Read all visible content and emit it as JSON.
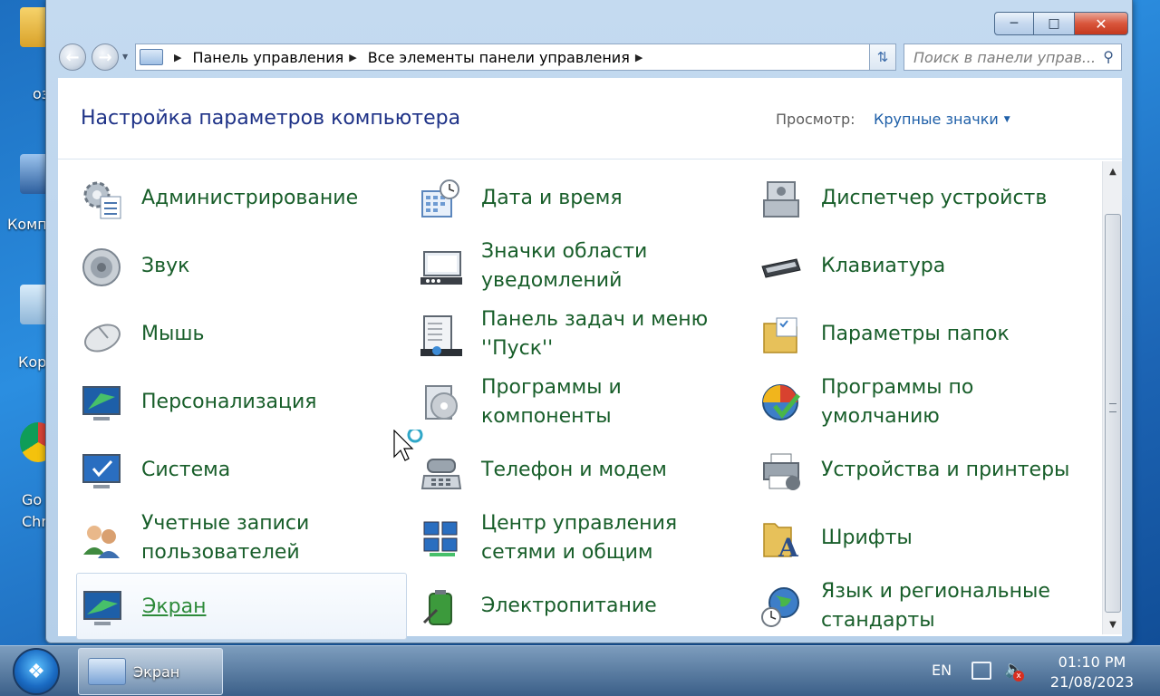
{
  "desktop": {
    "icons": [
      {
        "label": "oз"
      },
      {
        "label": "Комп"
      },
      {
        "label": "Кор"
      },
      {
        "label": "Go"
      },
      {
        "label": "Chr"
      }
    ]
  },
  "window": {
    "address": {
      "segments": [
        "Панель управления",
        "Все элементы панели управления"
      ]
    },
    "search": {
      "placeholder": "Поиск в панели управ..."
    },
    "header": {
      "title": "Настройка параметров компьютера",
      "view_label": "Просмотр:",
      "view_value": "Крупные значки"
    },
    "items": [
      {
        "label": "Администрирование",
        "icon": "admin-tools-icon"
      },
      {
        "label": "Дата и время",
        "icon": "calendar-clock-icon"
      },
      {
        "label": "Диспетчер устройств",
        "icon": "device-manager-icon"
      },
      {
        "label": "Звук",
        "icon": "speaker-icon"
      },
      {
        "label": "Значки области уведомлений",
        "icon": "notification-area-icon"
      },
      {
        "label": "Клавиатура",
        "icon": "keyboard-icon"
      },
      {
        "label": "Мышь",
        "icon": "mouse-icon"
      },
      {
        "label": "Панель задач и меню ''Пуск''",
        "icon": "taskbar-start-icon"
      },
      {
        "label": "Параметры папок",
        "icon": "folder-options-icon"
      },
      {
        "label": "Персонализация",
        "icon": "personalization-icon"
      },
      {
        "label": "Программы и компоненты",
        "icon": "programs-features-icon"
      },
      {
        "label": "Программы по умолчанию",
        "icon": "default-programs-icon"
      },
      {
        "label": "Система",
        "icon": "system-icon"
      },
      {
        "label": "Телефон и модем",
        "icon": "phone-modem-icon"
      },
      {
        "label": "Устройства и принтеры",
        "icon": "devices-printers-icon"
      },
      {
        "label": "Учетные записи пользователей",
        "icon": "user-accounts-icon"
      },
      {
        "label": "Центр управления сетями и общим",
        "icon": "network-center-icon"
      },
      {
        "label": "Шрифты",
        "icon": "fonts-folder-icon"
      },
      {
        "label": "Экран",
        "icon": "display-icon",
        "selected": true
      },
      {
        "label": "Электропитание",
        "icon": "power-options-icon"
      },
      {
        "label": "Язык и региональные стандарты",
        "icon": "region-globe-icon"
      }
    ]
  },
  "taskbar": {
    "active_window": "Экран",
    "language": "EN",
    "time": "01:10 PM",
    "date": "21/08/2023"
  },
  "colors": {
    "link_green": "#185e2a",
    "title_blue": "#1e3287",
    "close_red": "#c4381e"
  }
}
